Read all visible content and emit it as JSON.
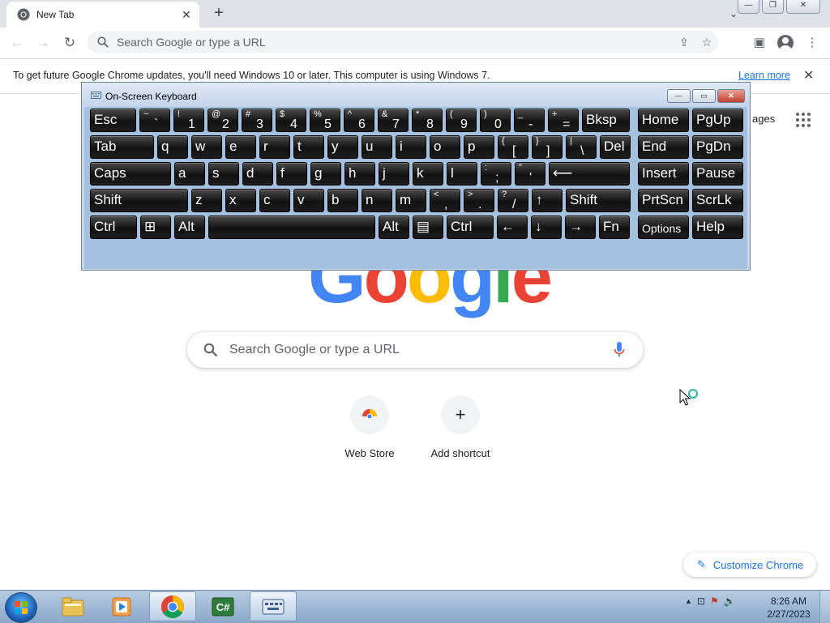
{
  "browser": {
    "tab_title": "New Tab",
    "tab_close_glyph": "✕",
    "new_tab_glyph": "+",
    "tab_search_glyph": "⌄",
    "window_controls": {
      "minimize": "—",
      "restore": "❐",
      "close": "✕"
    },
    "back_glyph": "←",
    "forward_glyph": "→",
    "reload_glyph": "↻",
    "omnibox_placeholder": "Search Google or type a URL",
    "share_glyph": "⇪",
    "star_glyph": "☆",
    "sidepanel_glyph": "▣",
    "menu_glyph": "⋮"
  },
  "infobar": {
    "message": "To get future Google Chrome updates, you'll need Windows 10 or later. This computer is using Windows 7.",
    "link": "Learn more",
    "close_glyph": "✕"
  },
  "ntp": {
    "images_link": "ages",
    "logo_letters": [
      "G",
      "o",
      "o",
      "g",
      "l",
      "e"
    ],
    "search_placeholder": "Search Google or type a URL",
    "shortcuts": [
      {
        "label": "Web Store",
        "icon": "web-store-icon"
      },
      {
        "label": "Add shortcut",
        "icon": "plus-icon",
        "glyph": "+"
      }
    ],
    "customize_label": "Customize Chrome",
    "customize_glyph": "✎"
  },
  "osk": {
    "title": "On-Screen Keyboard",
    "controls": {
      "minimize": "—",
      "restore": "▭",
      "close": "✕"
    },
    "rows": [
      [
        {
          "label": "Esc"
        },
        {
          "top": "~",
          "bot": "`"
        },
        {
          "top": "!",
          "bot": "1"
        },
        {
          "top": "@",
          "bot": "2"
        },
        {
          "top": "#",
          "bot": "3"
        },
        {
          "top": "$",
          "bot": "4"
        },
        {
          "top": "%",
          "bot": "5"
        },
        {
          "top": "^",
          "bot": "6"
        },
        {
          "top": "&",
          "bot": "7"
        },
        {
          "top": "*",
          "bot": "8"
        },
        {
          "top": "(",
          "bot": "9"
        },
        {
          "top": ")",
          "bot": "0"
        },
        {
          "top": "_",
          "bot": "-"
        },
        {
          "top": "+",
          "bot": "="
        },
        {
          "label": "Bksp"
        },
        {
          "label": "Home"
        },
        {
          "label": "PgUp"
        }
      ],
      [
        {
          "label": "Tab"
        },
        {
          "label": "q"
        },
        {
          "label": "w"
        },
        {
          "label": "e"
        },
        {
          "label": "r"
        },
        {
          "label": "t"
        },
        {
          "label": "y"
        },
        {
          "label": "u"
        },
        {
          "label": "i"
        },
        {
          "label": "o"
        },
        {
          "label": "p"
        },
        {
          "top": "{",
          "bot": "["
        },
        {
          "top": "}",
          "bot": "]"
        },
        {
          "top": "|",
          "bot": "\\"
        },
        {
          "label": "Del"
        },
        {
          "label": "End"
        },
        {
          "label": "PgDn"
        }
      ],
      [
        {
          "label": "Caps"
        },
        {
          "label": "a"
        },
        {
          "label": "s"
        },
        {
          "label": "d"
        },
        {
          "label": "f"
        },
        {
          "label": "g"
        },
        {
          "label": "h"
        },
        {
          "label": "j"
        },
        {
          "label": "k"
        },
        {
          "label": "l"
        },
        {
          "top": ":",
          "bot": ";"
        },
        {
          "top": "\"",
          "bot": "'"
        },
        {
          "label": "⟵"
        },
        {
          "label": "Insert"
        },
        {
          "label": "Pause"
        }
      ],
      [
        {
          "label": "Shift"
        },
        {
          "label": "z"
        },
        {
          "label": "x"
        },
        {
          "label": "c"
        },
        {
          "label": "v"
        },
        {
          "label": "b"
        },
        {
          "label": "n"
        },
        {
          "label": "m"
        },
        {
          "top": "<",
          "bot": ","
        },
        {
          "top": ">",
          "bot": "."
        },
        {
          "top": "?",
          "bot": "/"
        },
        {
          "label": "↑"
        },
        {
          "label": "Shift"
        },
        {
          "label": "PrtScn"
        },
        {
          "label": "ScrLk"
        }
      ],
      [
        {
          "label": "Ctrl"
        },
        {
          "label": "⊞"
        },
        {
          "label": "Alt"
        },
        {
          "label": ""
        },
        {
          "label": "Alt"
        },
        {
          "label": "▤"
        },
        {
          "label": "Ctrl"
        },
        {
          "label": "←"
        },
        {
          "label": "↓"
        },
        {
          "label": "→"
        },
        {
          "label": "Fn"
        },
        {
          "label": "Options"
        },
        {
          "label": "Help"
        }
      ]
    ]
  },
  "taskbar": {
    "apps": [
      {
        "name": "explorer-icon"
      },
      {
        "name": "media-player-icon"
      },
      {
        "name": "chrome-icon",
        "active": true
      },
      {
        "name": "csharp-icon"
      },
      {
        "name": "osk-icon",
        "active": true
      }
    ],
    "tray_glyphs": [
      "▲",
      "⊡",
      "⚑",
      "🔊"
    ],
    "time": "8:26 AM",
    "date": "2/27/2023"
  }
}
